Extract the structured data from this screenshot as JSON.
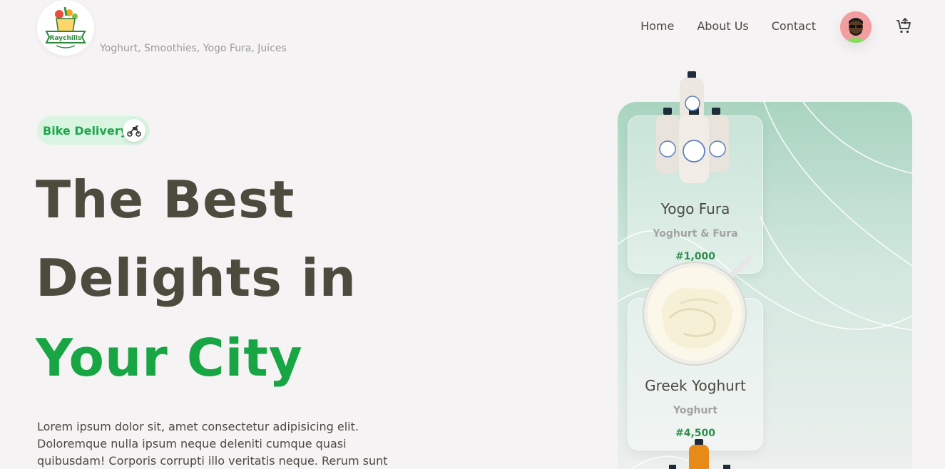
{
  "header": {
    "logo_text": "Raychills",
    "tagline": "Yoghurt, Smoothies, Yogo Fura, Juices",
    "nav": [
      {
        "label": "Home"
      },
      {
        "label": "About Us"
      },
      {
        "label": "Contact"
      }
    ]
  },
  "hero": {
    "badge_label": "Bike Delivery",
    "line1": "The Best",
    "line2": "Delights in",
    "line3": "Your City",
    "description": "Lorem ipsum dolor sit, amet consectetur adipisicing elit. Doloremque nulla ipsum neque deleniti cumque quasi quibusdam! Corporis corrupti illo veritatis neque. Rerum sunt"
  },
  "products": [
    {
      "name": "Yogo Fura",
      "subtitle": "Yoghurt & Fura",
      "price": "#1,000"
    },
    {
      "name": "Greek Yoghurt",
      "subtitle": "Yoghurt",
      "price": "#4,500"
    }
  ],
  "colors": {
    "accent": "#18a543",
    "text": "#4d4a3e",
    "background": "#f5f3f4"
  },
  "icons": {
    "badge": "scooter-icon",
    "cart": "cart-icon",
    "avatar": "user-avatar"
  }
}
